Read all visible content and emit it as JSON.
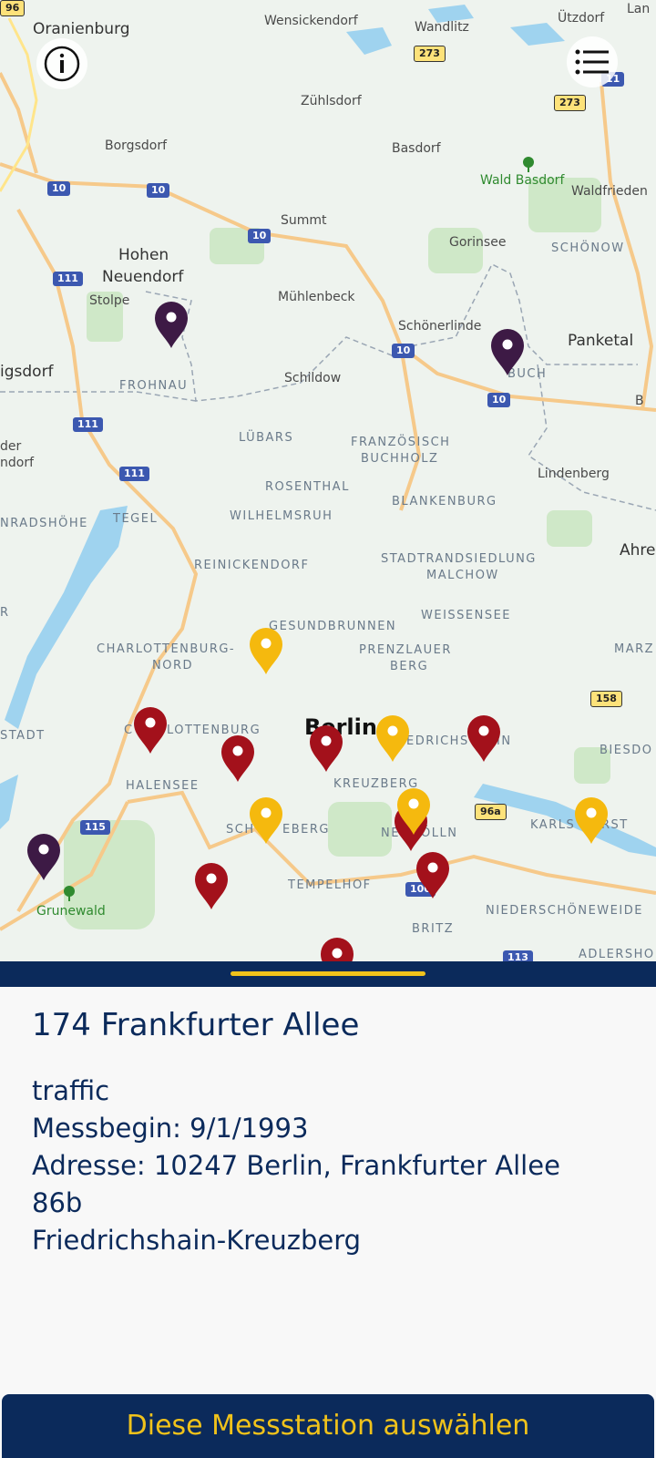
{
  "map": {
    "city_label": "Berlin",
    "places": {
      "oranienburg": "Oranienburg",
      "wensickendorf": "Wensickendorf",
      "wandlitz": "Wandlitz",
      "utzdorf": "Ützdorf",
      "lan": "Lan",
      "zuhlsdorf": "Zühlsdorf",
      "borgsdorf": "Borgsdorf",
      "basdorf": "Basdorf",
      "wald_basdorf": "Wald Basdorf",
      "waldfrieden": "Waldfrieden",
      "summt": "Summt",
      "gorinsee": "Gorinsee",
      "schonow": "SCHÖNOW",
      "hohen": "Hohen",
      "neuendorf": "Neuendorf",
      "stolpe": "Stolpe",
      "muhlenbeck": "Mühlenbeck",
      "schonerlinde": "Schönerlinde",
      "panketal": "Panketal",
      "igsdorf": "igsdorf",
      "frohnau": "FROHNAU",
      "schildow": "Schildow",
      "buch": "BUCH",
      "b_edge": "B",
      "der": "der",
      "ndorf": "ndorf",
      "lubars": "LÜBARS",
      "franzosisch": "FRANZÖSISCH",
      "buchholz": "BUCHHOLZ",
      "lindenberg": "Lindenberg",
      "rosenthal": "ROSENTHAL",
      "blankenburg": "BLANKENBURG",
      "nradshohe": "NRADSHÖHE",
      "tegel": "TEGEL",
      "wilhelmsruh": "WILHELMSRUH",
      "ahre": "Ahre",
      "reinickendorf": "REINICKENDORF",
      "stadtrandsiedlung": "STADTRANDSIEDLUNG",
      "malchow": "MALCHOW",
      "r_edge": "R",
      "gesundbrunnen": "GESUNDBRUNNEN",
      "weissensee": "WEISSENSEE",
      "charlottenburg_nord_1": "CHARLOTTENBURG-",
      "charlottenburg_nord_2": "NORD",
      "prenzlauer": "PRENZLAUER",
      "berg": "BERG",
      "marz": "MARZ",
      "stadt": "STADT",
      "c_charlottenburg": "C",
      "lottenburg": "LOTTENBURG",
      "friedrichshain_a": "EDRICHS",
      "friedrichshain_b": "IN",
      "biesdo": "BIESDO",
      "halensee": "HALENSEE",
      "kreuzberg": "KREUZBERG",
      "sch": "SCH",
      "eberg": "EBERG",
      "ne": "NE",
      "olln": "ÖLLN",
      "karls": "KARLS",
      "rst": "RST",
      "tempelhof": "TEMPELHOF",
      "grunewald": "Grunewald",
      "niederschoneweide": "NIEDERSCHÖNEWEIDE",
      "britz": "BRITZ",
      "adlershof": "ADLERSHO"
    },
    "shields": {
      "s96": "96",
      "s273a": "273",
      "s273b": "273",
      "s11": "11",
      "s10a": "10",
      "s10b": "10",
      "s10c": "10",
      "s10d": "10",
      "s10e": "10",
      "s111a": "111",
      "s111b": "111",
      "s111c": "111",
      "s158": "158",
      "s96a": "96a",
      "s115": "115",
      "s100": "100",
      "s113": "113"
    },
    "marker_colors": {
      "purple": "#3d1a45",
      "red": "#a3111b",
      "yellow": "#f5b90e"
    }
  },
  "sheet": {
    "title": "174 Frankfurter Allee",
    "type": "traffic",
    "start": "Messbegin: 9/1/1993",
    "address_line1": "Adresse: 10247 Berlin, Frankfurter Allee",
    "address_line2": "86b",
    "district": "Friedrichshain-Kreuzberg"
  },
  "select_button": "Diese Messstation auswählen"
}
